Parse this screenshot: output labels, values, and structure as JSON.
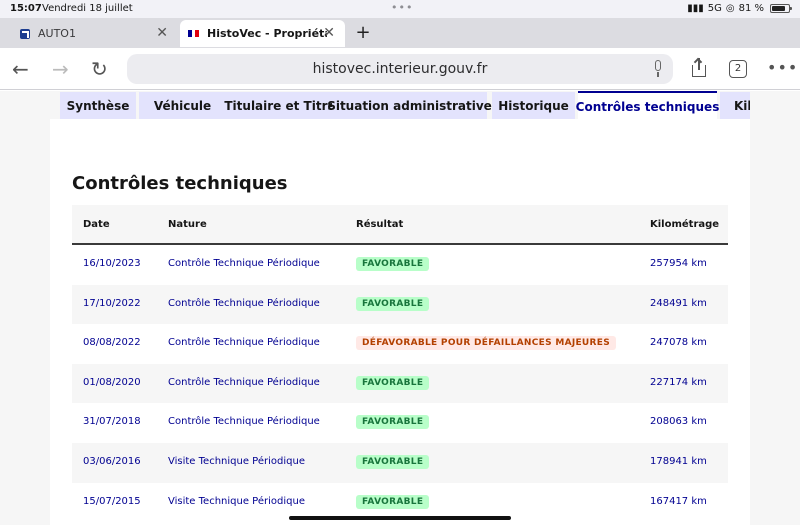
{
  "status_bar": {
    "time": "15:07",
    "date": "Vendredi 18 juillet",
    "network": "5G",
    "battery": "81 %",
    "battery_level": 0.81
  },
  "browser": {
    "tabs": [
      {
        "label": "AUTO1"
      },
      {
        "label": "HistoVec - Propriétaire"
      }
    ],
    "new_tab": "+",
    "url": "histovec.interieur.gouv.fr",
    "tab_count": "2"
  },
  "page": {
    "nav_tabs": [
      {
        "label": "Synthèse"
      },
      {
        "label": "Véhicule"
      },
      {
        "label": "Titulaire et Titre"
      },
      {
        "label": "Situation administrative"
      },
      {
        "label": "Historique"
      },
      {
        "label": "Contrôles techniques"
      },
      {
        "label": "Kil"
      }
    ],
    "section_title": "Contrôles techniques",
    "table": {
      "headers": {
        "date": "Date",
        "nature": "Nature",
        "result": "Résultat",
        "km": "Kilométrage"
      },
      "rows": [
        {
          "date": "16/10/2023",
          "nature": "Contrôle Technique Périodique",
          "result": "FAVORABLE",
          "km": "257954 km"
        },
        {
          "date": "17/10/2022",
          "nature": "Contrôle Technique Périodique",
          "result": "FAVORABLE",
          "km": "248491 km"
        },
        {
          "date": "08/08/2022",
          "nature": "Contrôle Technique Périodique",
          "result": "DÉFAVORABLE POUR DÉFAILLANCES MAJEURES",
          "km": "247078 km"
        },
        {
          "date": "01/08/2020",
          "nature": "Contrôle Technique Périodique",
          "result": "FAVORABLE",
          "km": "227174 km"
        },
        {
          "date": "31/07/2018",
          "nature": "Contrôle Technique Périodique",
          "result": "FAVORABLE",
          "km": "208063 km"
        },
        {
          "date": "03/06/2016",
          "nature": "Visite Technique Périodique",
          "result": "FAVORABLE",
          "km": "178941 km"
        },
        {
          "date": "15/07/2015",
          "nature": "Visite Technique Périodique",
          "result": "FAVORABLE",
          "km": "167417 km"
        }
      ]
    }
  },
  "colors": {
    "accent": "#000091",
    "success_bg": "#b8fec9",
    "success_text": "#18753c",
    "error_bg": "#ffe9e6",
    "error_text": "#b34000",
    "tab_bg": "#e3e3fd"
  }
}
